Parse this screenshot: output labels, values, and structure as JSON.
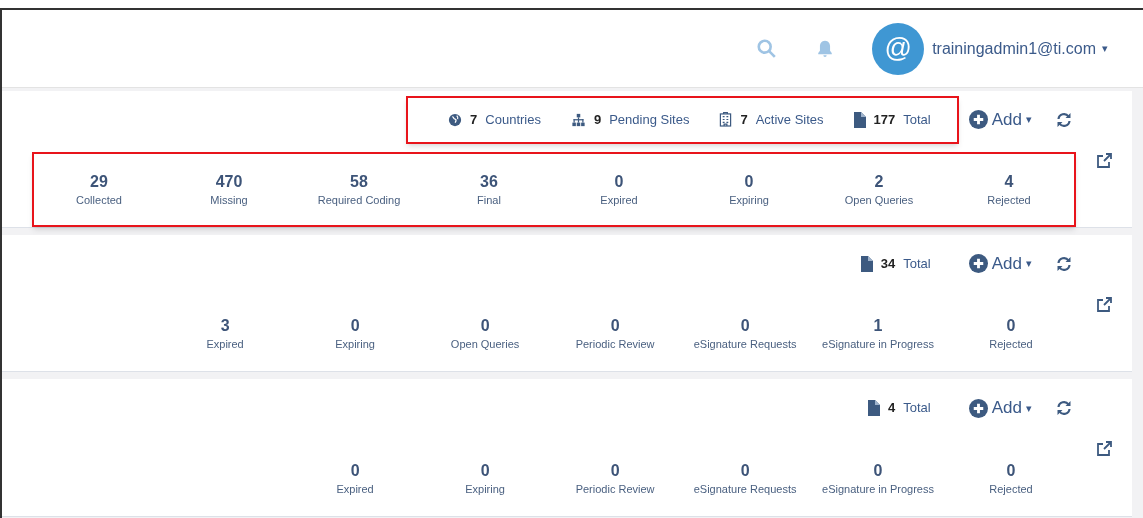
{
  "header": {
    "avatar": "@",
    "user": "trainingadmin1@ti.com",
    "user_caret": "▾"
  },
  "cards": [
    {
      "summary_highlighted": true,
      "stats_highlighted": true,
      "add": "Add",
      "add_caret": "▾",
      "summary": [
        {
          "kind": "globe",
          "count": "7",
          "label": "Countries"
        },
        {
          "kind": "sitemap",
          "count": "9",
          "label": "Pending Sites"
        },
        {
          "kind": "building",
          "count": "7",
          "label": "Active Sites"
        },
        {
          "kind": "file",
          "count": "177",
          "label": "Total"
        }
      ],
      "stats": [
        {
          "value": "29",
          "label": "Collected"
        },
        {
          "value": "470",
          "label": "Missing"
        },
        {
          "value": "58",
          "label": "Required Coding"
        },
        {
          "value": "36",
          "label": "Final"
        },
        {
          "value": "0",
          "label": "Expired"
        },
        {
          "value": "0",
          "label": "Expiring"
        },
        {
          "value": "2",
          "label": "Open Queries"
        },
        {
          "value": "4",
          "label": "Rejected"
        }
      ]
    },
    {
      "summary_highlighted": false,
      "stats_highlighted": false,
      "add": "Add",
      "add_caret": "▾",
      "summary": [
        {
          "kind": "file",
          "count": "34",
          "label": "Total"
        }
      ],
      "stats": [
        {
          "value": "3",
          "label": "Expired"
        },
        {
          "value": "0",
          "label": "Expiring"
        },
        {
          "value": "0",
          "label": "Open Queries"
        },
        {
          "value": "0",
          "label": "Periodic Review"
        },
        {
          "value": "0",
          "label": "eSignature Requests"
        },
        {
          "value": "1",
          "label": "eSignature in Progress"
        },
        {
          "value": "0",
          "label": "Rejected"
        }
      ]
    },
    {
      "summary_highlighted": false,
      "stats_highlighted": false,
      "add": "Add",
      "add_caret": "▾",
      "summary": [
        {
          "kind": "file",
          "count": "4",
          "label": "Total"
        }
      ],
      "stats": [
        {
          "value": "0",
          "label": "Expired"
        },
        {
          "value": "0",
          "label": "Expiring"
        },
        {
          "value": "0",
          "label": "Periodic Review"
        },
        {
          "value": "0",
          "label": "eSignature Requests"
        },
        {
          "value": "0",
          "label": "eSignature in Progress"
        },
        {
          "value": "0",
          "label": "Rejected"
        }
      ]
    }
  ]
}
